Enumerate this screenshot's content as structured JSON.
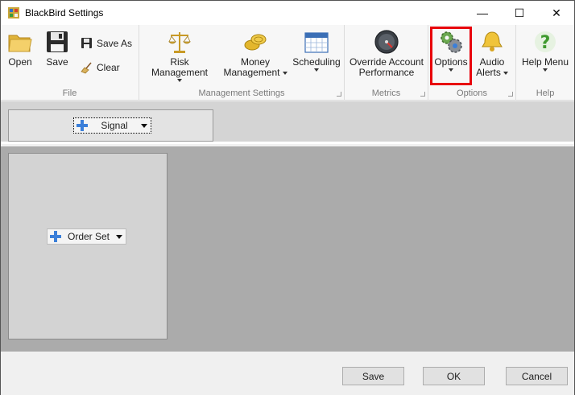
{
  "window": {
    "title": "BlackBird Settings",
    "controls": {
      "minimize": "—",
      "maximize": "☐",
      "close": "✕"
    }
  },
  "ribbon": {
    "groups": {
      "file": "File",
      "management_settings": "Management Settings",
      "metrics": "Metrics",
      "options": "Options",
      "help": "Help"
    },
    "buttons": {
      "open": "Open",
      "save": "Save",
      "save_as": "Save  As",
      "clear": "Clear",
      "risk_management": "Risk Management",
      "money_line1": "Money",
      "money_line2": "Management",
      "scheduling": "Scheduling",
      "override_line1": "Override Account",
      "override_line2": "Performance",
      "options": "Options",
      "audio_line1": "Audio",
      "audio_line2": "Alerts",
      "help_menu": "Help Menu"
    }
  },
  "content": {
    "signal_button": "Signal",
    "order_set_button": "Order Set"
  },
  "footer": {
    "save": "Save",
    "ok": "OK",
    "cancel": "Cancel"
  },
  "colors": {
    "highlight": "#e8000b",
    "main_background": "#ababab",
    "panel_background": "#d3d3d3",
    "plus_icon": "#3b7fd9"
  },
  "icons": {
    "app": "blackbird-app-icon",
    "open": "folder-icon",
    "save": "floppy-disk-icon",
    "save_as": "floppy-disk-pen-icon",
    "clear": "broom-icon",
    "risk_management": "balance-scale-icon",
    "money_management": "coins-icon",
    "scheduling": "calendar-icon",
    "override": "gauge-icon",
    "options": "gears-icon",
    "audio_alerts": "bell-icon",
    "help_menu": "question-mark-icon",
    "add": "plus-icon"
  }
}
